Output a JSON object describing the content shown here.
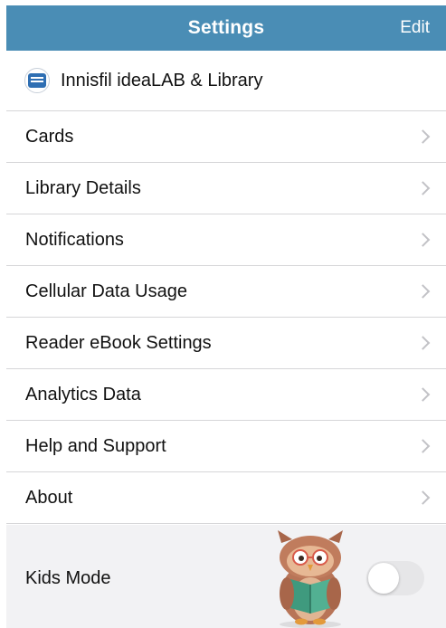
{
  "navbar": {
    "title": "Settings",
    "edit_label": "Edit",
    "color": "#4a8db5"
  },
  "library": {
    "name": "Innisfil ideaLAB & Library"
  },
  "menu": {
    "items": [
      {
        "label": "Cards"
      },
      {
        "label": "Library Details"
      },
      {
        "label": "Notifications"
      },
      {
        "label": "Cellular Data Usage"
      },
      {
        "label": "Reader eBook Settings"
      },
      {
        "label": "Analytics Data"
      },
      {
        "label": "Help and Support"
      },
      {
        "label": "About"
      }
    ]
  },
  "kids_mode": {
    "label": "Kids Mode",
    "enabled": false,
    "mascot": "owl-reading-book"
  },
  "icons": {
    "row_chevron": "chevron-right-icon",
    "library_logo": "library-logo-icon"
  }
}
